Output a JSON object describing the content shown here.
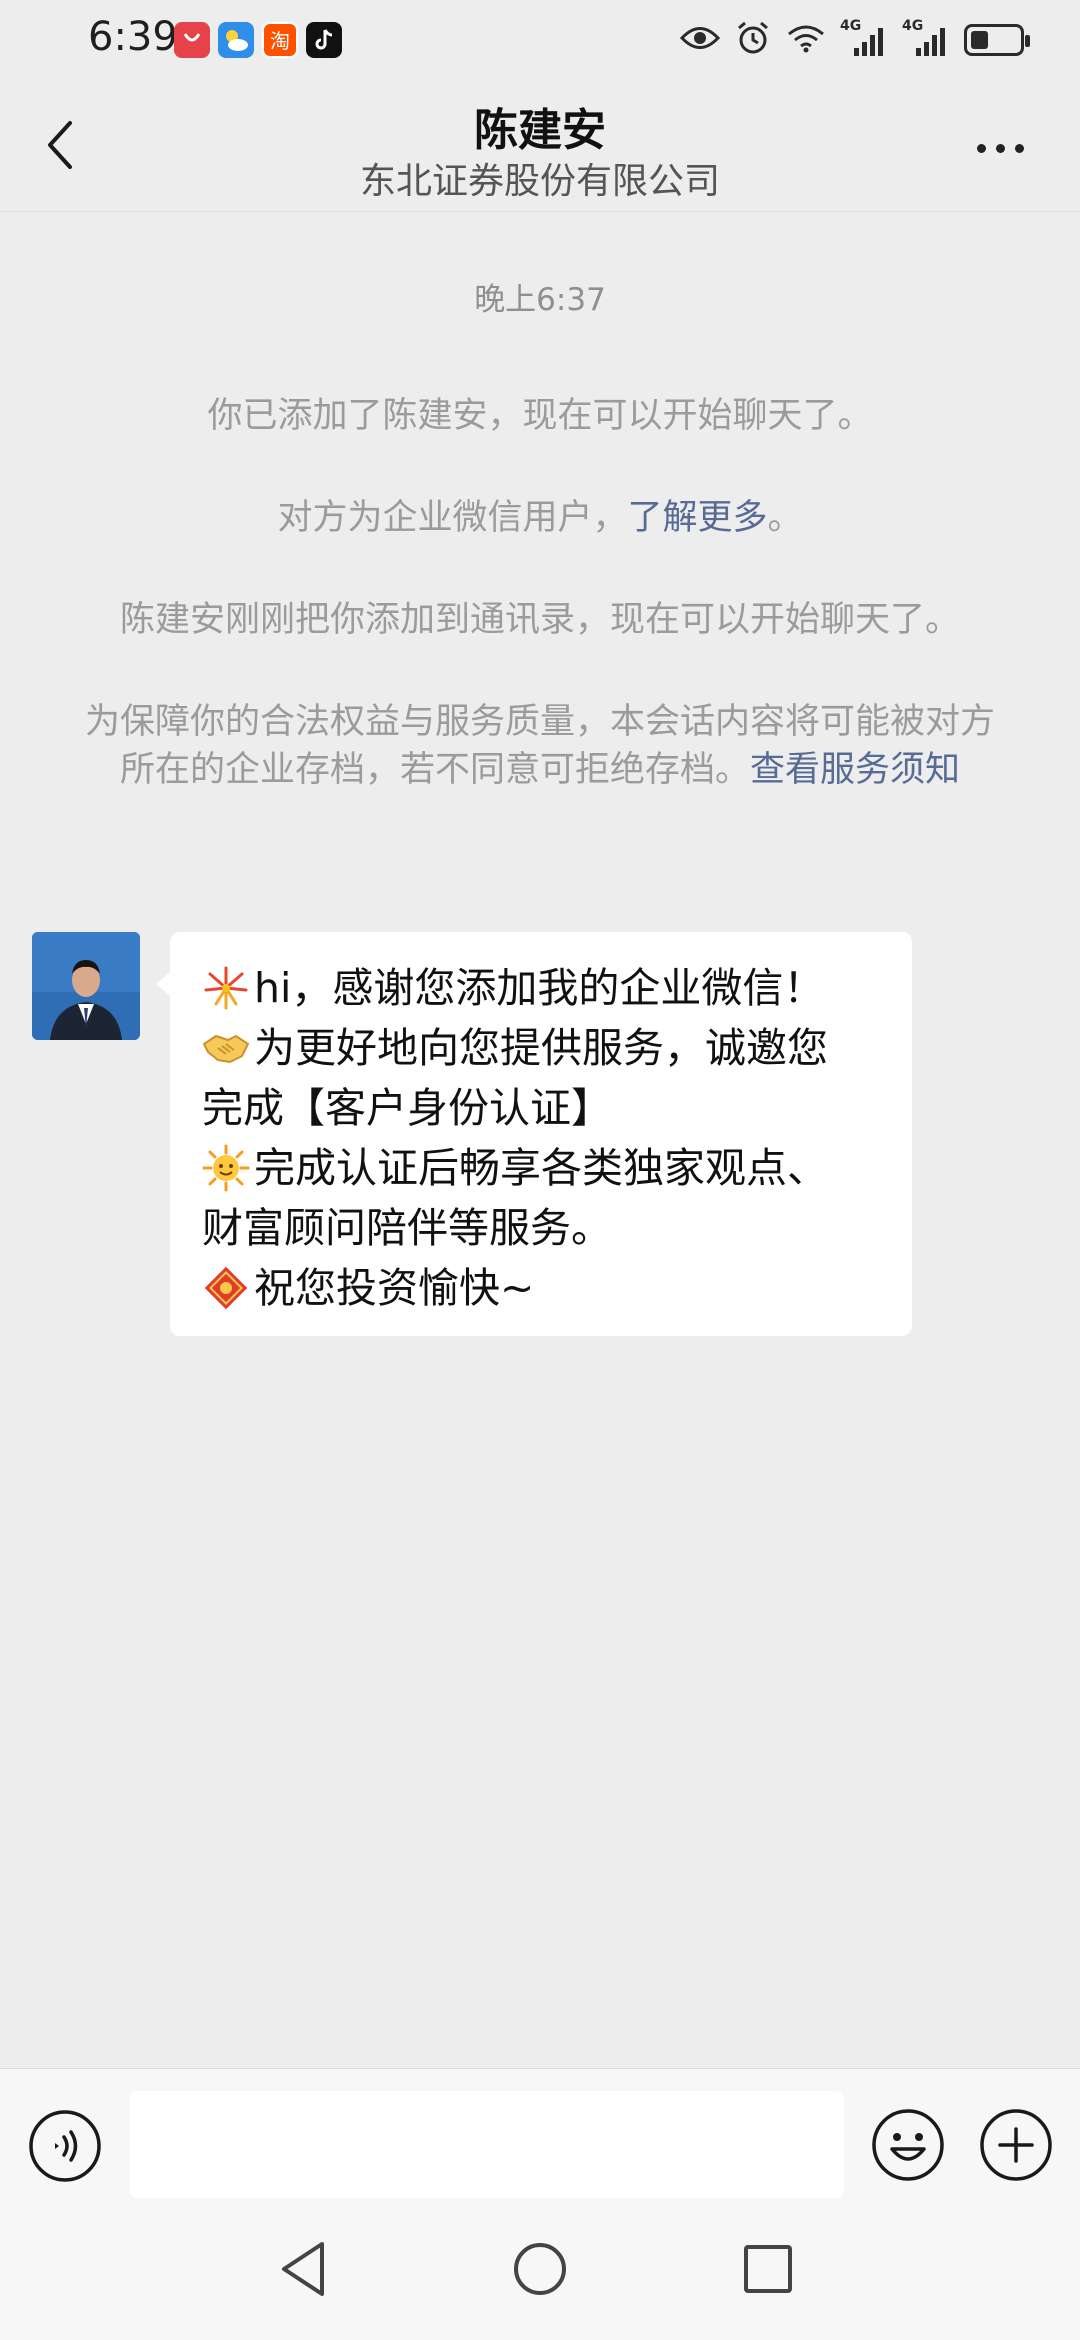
{
  "status_bar": {
    "time": "6:39",
    "notification_apps": [
      "huawei-appgallery-icon",
      "weather-icon",
      "taobao-icon",
      "tiktok-icon"
    ],
    "status_icons": [
      "eye-comfort-icon",
      "alarm-icon",
      "wifi-icon",
      "signal-4g-icon",
      "signal-4g-icon",
      "battery-icon"
    ],
    "network_label_1": "4G",
    "network_label_2": "4G",
    "battery_level": 0.35
  },
  "header": {
    "title": "陈建安",
    "subtitle": "东北证券股份有限公司"
  },
  "chat": {
    "timestamp": "晚上6:37",
    "system_messages": {
      "added": "你已添加了陈建安，现在可以开始聊天了。",
      "enterprise_prefix": "对方为企业微信用户，",
      "enterprise_link": "了解更多",
      "enterprise_suffix": "。",
      "contact_added": "陈建安刚刚把你添加到通讯录，现在可以开始聊天了。",
      "archive_text": "为保障你的合法权益与服务质量，本会话内容将可能被对方所在的企业存档，若不同意可拒绝存档。",
      "archive_link": "查看服务须知"
    },
    "message": {
      "lines": [
        {
          "emoji": "fireworks-emoji",
          "text": "hi，感谢您添加我的企业微信！"
        },
        {
          "emoji": "handshake-emoji",
          "text": "为更好地向您提供服务，诚邀您"
        },
        {
          "emoji": "",
          "text": "完成【客户身份认证】"
        },
        {
          "emoji": "sun-emoji",
          "text": "完成认证后畅享各类独家观点、"
        },
        {
          "emoji": "",
          "text": "财富顾问陪伴等服务。"
        },
        {
          "emoji": "fortune-emoji",
          "text": "祝您投资愉快~"
        }
      ]
    }
  },
  "input_bar": {
    "value": "",
    "placeholder": ""
  },
  "colors": {
    "background": "#ededed",
    "link": "#576b95",
    "system_text": "#9b9b9b",
    "bubble": "#ffffff"
  }
}
